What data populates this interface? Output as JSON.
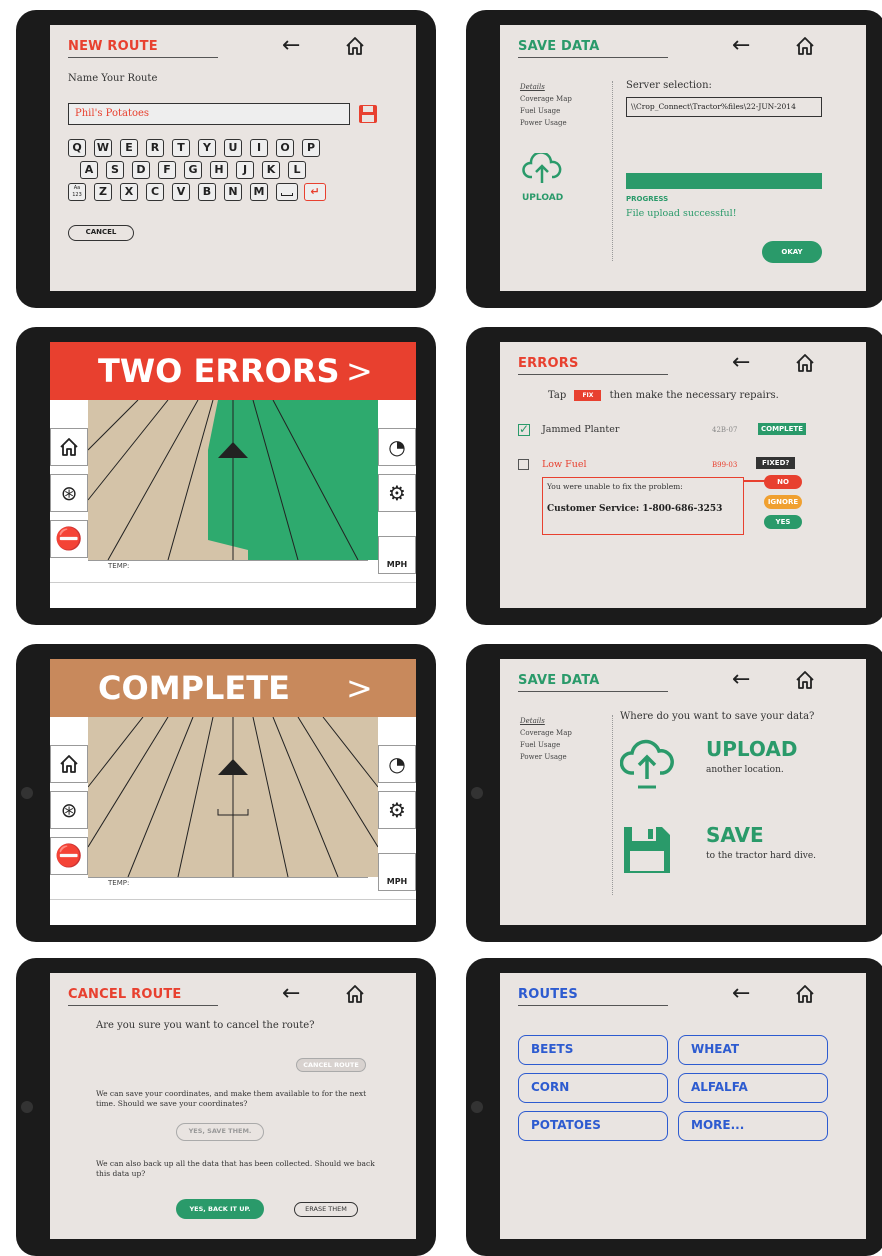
{
  "new_route": {
    "title": "NEW ROUTE",
    "prompt": "Name Your Route",
    "input_value": "Phil's Potatoes",
    "keys_row1": [
      "Q",
      "W",
      "E",
      "R",
      "T",
      "Y",
      "U",
      "I",
      "O",
      "P"
    ],
    "keys_row2": [
      "A",
      "S",
      "D",
      "F",
      "G",
      "H",
      "J",
      "K",
      "L"
    ],
    "keys_row3": [
      "Z",
      "X",
      "C",
      "V",
      "B",
      "N",
      "M"
    ],
    "mode_key": "Aa\n123",
    "cancel_label": "CANCEL"
  },
  "save_data_upload": {
    "title": "SAVE DATA",
    "sidebar": [
      "Details",
      "Coverage Map",
      "Fuel Usage",
      "Power Usage"
    ],
    "upload_label": "UPLOAD",
    "server_label": "Server selection:",
    "server_path": "\\\\Crop_Connect\\Tractor%files\\22-JUN-2014",
    "progress_label": "PROGRESS",
    "progress_value": 1.0,
    "status_text": "File upload successful!",
    "okay_label": "OKAY"
  },
  "two_errors": {
    "banner": "TWO ERRORS",
    "chevron": ">",
    "temp_label": "TEMP:",
    "mph_label": "MPH",
    "banner_color": "#e8402f"
  },
  "errors": {
    "title": "ERRORS",
    "instruction_pre": "Tap",
    "fix_badge": "FIX",
    "instruction_post": "then make the necessary repairs.",
    "items": [
      {
        "name": "Jammed Planter",
        "code": "42B-07",
        "status": "COMPLETE"
      },
      {
        "name": "Low Fuel",
        "code": "B99-03",
        "status": "FIXED?"
      }
    ],
    "unable_text": "You were unable to fix the problem:",
    "customer_service": "Customer Service:  1-800-686-3253",
    "no_label": "NO",
    "ignore_label": "IGNORE",
    "yes_label": "YES"
  },
  "complete": {
    "banner": "COMPLETE",
    "chevron": ">",
    "temp_label": "TEMP:",
    "mph_label": "MPH",
    "banner_color": "#c8895c"
  },
  "save_data_choice": {
    "title": "SAVE DATA",
    "sidebar": [
      "Details",
      "Coverage Map",
      "Fuel Usage",
      "Power Usage"
    ],
    "question": "Where do you want to save your data?",
    "upload_title": "UPLOAD",
    "upload_sub": "another location.",
    "save_title": "SAVE",
    "save_sub": "to the tractor hard dive."
  },
  "cancel_route": {
    "title": "CANCEL ROUTE",
    "question": "Are you sure you want to cancel the route?",
    "cancel_btn": "CANCEL ROUTE",
    "coords_text": "We can save your coordinates, and make them available to for the next time. Should we save your coordinates?",
    "save_coords_btn": "YES, SAVE THEM.",
    "backup_text": "We can also back up all the data that has been collected. Should we back this data up?",
    "backup_btn": "YES, BACK IT UP.",
    "erase_btn": "ERASE THEM"
  },
  "routes": {
    "title": "ROUTES",
    "items": [
      "BEETS",
      "WHEAT",
      "CORN",
      "ALFALFA",
      "POTATOES",
      "MORE..."
    ]
  }
}
